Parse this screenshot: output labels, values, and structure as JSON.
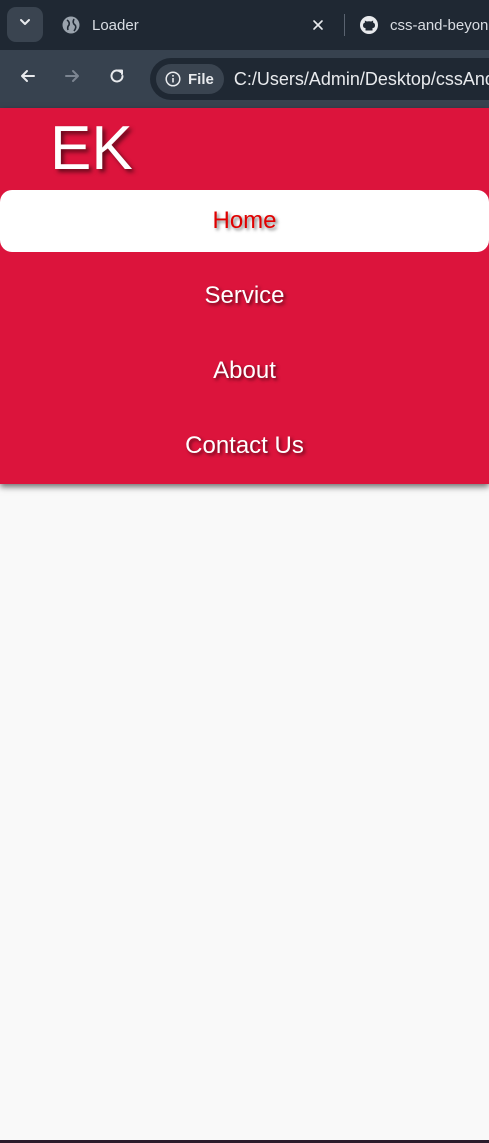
{
  "browser": {
    "tabs": [
      {
        "title": "Loader",
        "icon": "globe-icon",
        "active": true
      },
      {
        "title": "css-and-beyond",
        "icon": "github-icon",
        "active": false
      }
    ],
    "address_bar": {
      "chip_label": "File",
      "url": "C:/Users/Admin/Desktop/cssAndBeyond"
    }
  },
  "page": {
    "logo": "EK",
    "menu": [
      {
        "label": "Home",
        "active": true
      },
      {
        "label": "Service",
        "active": false
      },
      {
        "label": "About",
        "active": false
      },
      {
        "label": "Contact Us",
        "active": false
      }
    ]
  },
  "colors": {
    "accent": "#dc143c",
    "active_text": "#e00000",
    "background": "#f9f9f9",
    "tabstrip": "#1f2833",
    "toolbar": "#37424f"
  }
}
